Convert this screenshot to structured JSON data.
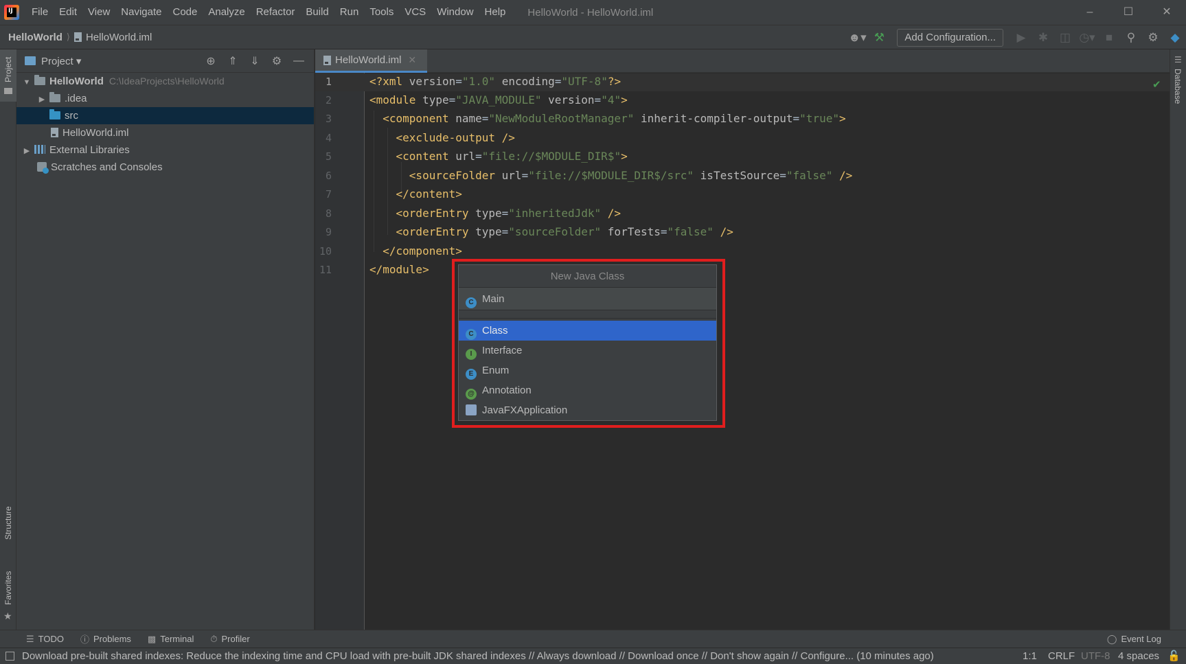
{
  "menubar": {
    "items": [
      "File",
      "Edit",
      "View",
      "Navigate",
      "Code",
      "Analyze",
      "Refactor",
      "Build",
      "Run",
      "Tools",
      "VCS",
      "Window",
      "Help"
    ],
    "window_title": "HelloWorld - HelloWorld.iml"
  },
  "navbar": {
    "project": "HelloWorld",
    "file": "HelloWorld.iml",
    "add_configuration": "Add Configuration..."
  },
  "stripes": {
    "left_top": "Project",
    "left_structure": "Structure",
    "left_favorites": "Favorites",
    "right_database": "Database"
  },
  "project_panel": {
    "title": "Project",
    "tree": [
      {
        "label": "HelloWorld",
        "path": "C:\\IdeaProjects\\HelloWorld"
      },
      {
        "label": ".idea"
      },
      {
        "label": "src"
      },
      {
        "label": "HelloWorld.iml"
      },
      {
        "label": "External Libraries"
      },
      {
        "label": "Scratches and Consoles"
      }
    ]
  },
  "editor": {
    "tab_label": "HelloWorld.iml",
    "line_numbers": [
      "1",
      "2",
      "3",
      "4",
      "5",
      "6",
      "7",
      "8",
      "9",
      "10",
      "11"
    ]
  },
  "popup": {
    "title": "New Java Class",
    "input_value": "Main",
    "items": [
      {
        "label": "Class",
        "icon": "class-icon",
        "letter": "C"
      },
      {
        "label": "Interface",
        "icon": "interface-icon",
        "letter": "I"
      },
      {
        "label": "Enum",
        "icon": "enum-icon",
        "letter": "E"
      },
      {
        "label": "Annotation",
        "icon": "annotation-icon",
        "letter": "@"
      },
      {
        "label": "JavaFXApplication",
        "icon": "javafx-icon",
        "letter": ""
      }
    ],
    "selected": "Class",
    "highlight_color": "#e01e1e"
  },
  "bottom_bar": {
    "todo": "TODO",
    "problems": "Problems",
    "terminal": "Terminal",
    "profiler": "Profiler",
    "event_log": "Event Log"
  },
  "status_bar": {
    "message": "Download pre-built shared indexes: Reduce the indexing time and CPU load with pre-built JDK shared indexes // Always download // Download once // Don't show again // Configure... (10 minutes ago)",
    "position": "1:1",
    "line_sep": "CRLF",
    "encoding": "UTF-8",
    "indent": "4 spaces"
  },
  "colors": {
    "accent": "#2f65ca",
    "selection_tree": "#0d293e",
    "xml_tag": "#e8bf6a",
    "xml_value": "#6a8759"
  }
}
